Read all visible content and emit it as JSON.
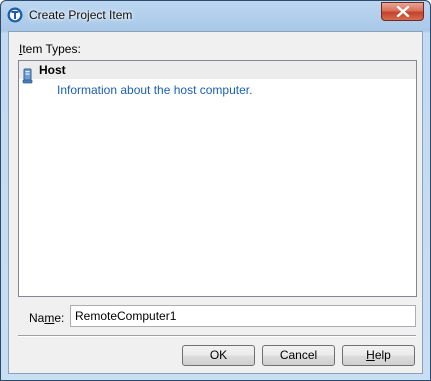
{
  "window": {
    "title": "Create Project Item",
    "close_icon": "close-icon",
    "app_icon": "app-logo-icon"
  },
  "item_types": {
    "label_prefix": "I",
    "label_rest": "tem Types:",
    "items": [
      {
        "icon": "host-computer-icon",
        "title": "Host",
        "description": "Information about the host computer."
      }
    ]
  },
  "name_field": {
    "label_prefix": "Na",
    "label_underlined": "m",
    "label_suffix": "e:",
    "value": "RemoteComputer1"
  },
  "buttons": {
    "ok": "OK",
    "cancel": "Cancel",
    "help_underlined": "H",
    "help_rest": "elp"
  }
}
